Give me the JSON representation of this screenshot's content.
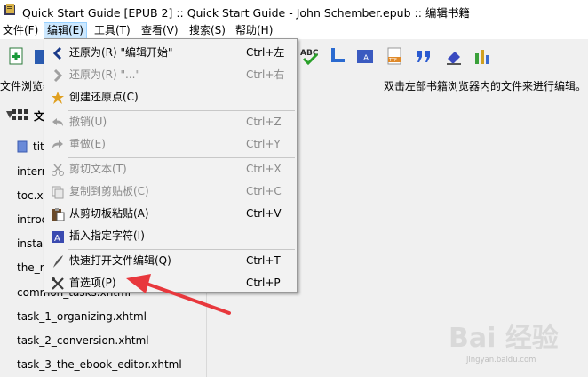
{
  "window": {
    "title": "Quick Start Guide [EPUB 2] :: Quick Start Guide - John Schember.epub :: 编辑书籍"
  },
  "menubar": {
    "items": [
      {
        "label": "文件(F)"
      },
      {
        "label": "编辑(E)"
      },
      {
        "label": "工具(T)"
      },
      {
        "label": "查看(V)"
      },
      {
        "label": "搜索(S)"
      },
      {
        "label": "帮助(H)"
      }
    ]
  },
  "toolbar": {
    "icons": [
      "add-file-icon",
      "book-icon",
      "spellcheck-icon",
      "reports-icon",
      "add-image-icon",
      "ttf-font-icon",
      "quotes-icon",
      "eraser-icon",
      "statistics-icon"
    ]
  },
  "dock": {
    "file_browser_label": "文件浏览器"
  },
  "main": {
    "hint": "双击左部书籍浏览器内的文件来进行编辑。"
  },
  "filetree": {
    "root_label": "文",
    "items": [
      "tit",
      "intern",
      "toc.xh",
      "introd",
      "instal",
      "the_m",
      "common_tasks.xhtml",
      "task_1_organizing.xhtml",
      "task_2_conversion.xhtml",
      "task_3_the_ebook_editor.xhtml"
    ]
  },
  "edit_menu": {
    "items": [
      {
        "label": "还原为(R) \"编辑开始\"",
        "shortcut": "Ctrl+左",
        "enabled": true,
        "icon": "chevron-left-icon"
      },
      {
        "label": "还原为(R) \"...\"",
        "shortcut": "Ctrl+右",
        "enabled": false,
        "icon": "chevron-right-icon"
      },
      {
        "label": "创建还原点(C)",
        "shortcut": "",
        "enabled": true,
        "icon": "checkpoint-star-icon"
      },
      {
        "label": "撤销(U)",
        "shortcut": "Ctrl+Z",
        "enabled": false,
        "icon": "undo-icon"
      },
      {
        "label": "重做(E)",
        "shortcut": "Ctrl+Y",
        "enabled": false,
        "icon": "redo-icon"
      },
      {
        "label": "剪切文本(T)",
        "shortcut": "Ctrl+X",
        "enabled": false,
        "icon": "scissors-icon"
      },
      {
        "label": "复制到剪贴板(C)",
        "shortcut": "Ctrl+C",
        "enabled": false,
        "icon": "copy-icon"
      },
      {
        "label": "从剪切板粘贴(A)",
        "shortcut": "Ctrl+V",
        "enabled": true,
        "icon": "paste-icon"
      },
      {
        "label": "插入指定字符(I)",
        "shortcut": "",
        "enabled": true,
        "icon": "insert-character-icon"
      },
      {
        "label": "快速打开文件编辑(Q)",
        "shortcut": "Ctrl+T",
        "enabled": true,
        "icon": "quill-icon"
      },
      {
        "label": "首选项(P)",
        "shortcut": "Ctrl+P",
        "enabled": true,
        "icon": "preferences-tools-icon"
      }
    ]
  },
  "watermark": {
    "brand": "Bai 经验",
    "url": "jingyan.baidu.com"
  },
  "colors": {
    "menu_highlight": "#cce8ff",
    "arrow": "#e8383d"
  }
}
